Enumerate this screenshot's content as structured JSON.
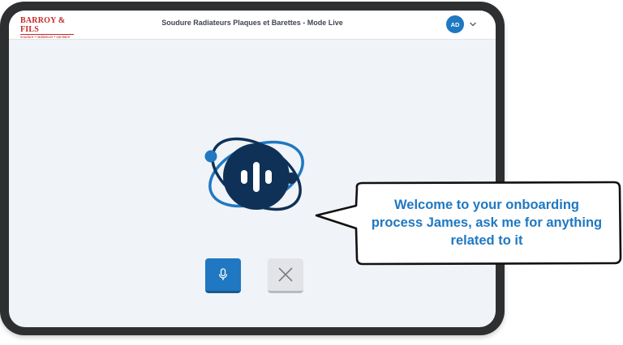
{
  "header": {
    "logo_text": "BARROY & FILS",
    "logo_subtext": "soudure • radiateurs • sanitaire",
    "title": "Soudure Radiateurs Plaques et Barettes - Mode Live",
    "avatar_initials": "AD"
  },
  "assistant": {
    "icon": "voice-assistant-orb-icon"
  },
  "controls": {
    "mic_icon": "microphone-icon",
    "close_icon": "close-icon"
  },
  "speech_bubble": {
    "line1": "Welcome to your onboarding",
    "line2": "process James, ask me for anything",
    "line3": "related to it"
  },
  "colors": {
    "accent": "#1f78c1",
    "navy": "#0f3157",
    "frame": "#2e2f31",
    "screen_bg": "#f0f3f7"
  }
}
